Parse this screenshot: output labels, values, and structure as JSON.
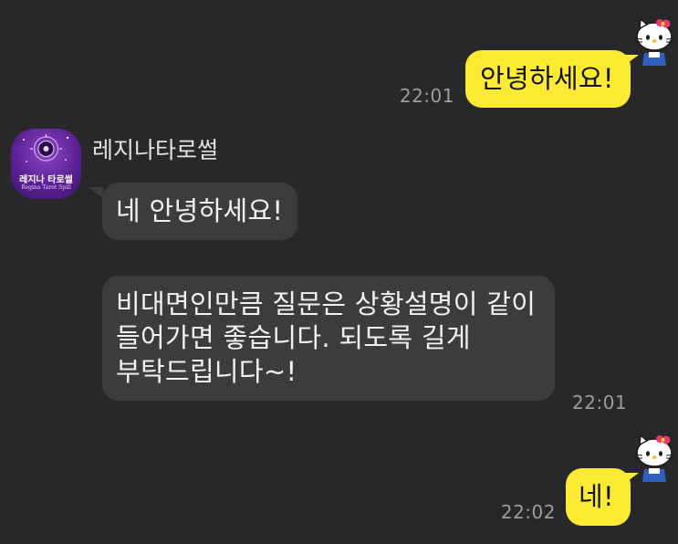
{
  "chat": {
    "contact": {
      "name": "레지나타로썰",
      "avatar_brand_name": "레지나 타로썰",
      "avatar_brand_sub": "Regina Tarot Spill"
    },
    "messages": [
      {
        "sender": "me",
        "text": "안녕하세요!",
        "time": "22:01"
      },
      {
        "sender": "contact",
        "text": "네 안녕하세요!",
        "time": ""
      },
      {
        "sender": "contact",
        "text": "비대면인만큼 질문은 상황설명이 같이\n들어가면 좋습니다. 되도록 길게\n부탁드립니다~!",
        "time": "22:01"
      },
      {
        "sender": "me",
        "text": "네!",
        "time": "22:02"
      }
    ]
  },
  "colors": {
    "background": "#28282b",
    "my_bubble": "#fdea35",
    "their_bubble": "#3c3c3f",
    "time_text": "#9d9d9d"
  },
  "icons": {
    "my_avatar": "hello-kitty-icon",
    "contact_avatar": "crystal-ball-icon"
  }
}
